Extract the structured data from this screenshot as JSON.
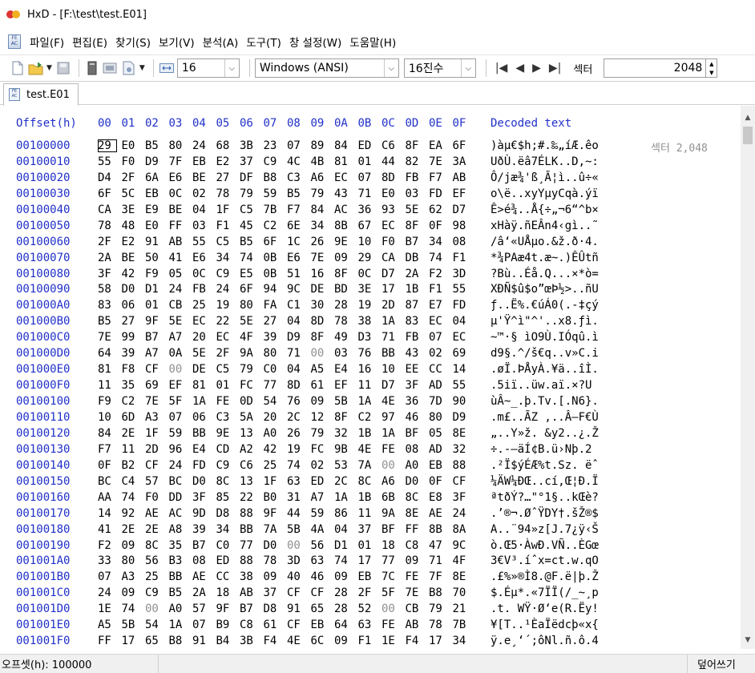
{
  "window": {
    "title": "HxD - [F:\\test\\test.E01]"
  },
  "menu": [
    "파일(F)",
    "편집(E)",
    "찾기(S)",
    "보기(V)",
    "분석(A)",
    "도구(T)",
    "창 설정(W)",
    "도움말(H)"
  ],
  "toolbar": {
    "bytes_per_row": "16",
    "charset": "Windows (ANSI)",
    "offset_base": "16진수",
    "sector_label": "섹터",
    "sector_value": "2048"
  },
  "tab": {
    "label": "test.E01"
  },
  "editor": {
    "offset_header": "Offset(h)",
    "column_headers": [
      "00",
      "01",
      "02",
      "03",
      "04",
      "05",
      "06",
      "07",
      "08",
      "09",
      "0A",
      "0B",
      "0C",
      "0D",
      "0E",
      "0F"
    ],
    "decoded_header": "Decoded text",
    "sector_marker": "섹터 2,048",
    "rows": [
      {
        "offset": "00100000",
        "hex": [
          "29",
          "E0",
          "B5",
          "80",
          "24",
          "68",
          "3B",
          "23",
          "07",
          "89",
          "84",
          "ED",
          "C6",
          "8F",
          "EA",
          "6F"
        ],
        "text": ")àµ€$h;#.‰„íÆ.êo"
      },
      {
        "offset": "00100010",
        "hex": [
          "55",
          "F0",
          "D9",
          "7F",
          "EB",
          "E2",
          "37",
          "C9",
          "4C",
          "4B",
          "81",
          "01",
          "44",
          "82",
          "7E",
          "3A"
        ],
        "text": "UðÙ.ëâ7ÉLK..D‚~:"
      },
      {
        "offset": "00100020",
        "hex": [
          "D4",
          "2F",
          "6A",
          "E6",
          "BE",
          "27",
          "DF",
          "B8",
          "C3",
          "A6",
          "EC",
          "07",
          "8D",
          "FB",
          "F7",
          "AB"
        ],
        "text": "Ô/jæ¾'ß¸Ã¦ì..û÷«"
      },
      {
        "offset": "00100030",
        "hex": [
          "6F",
          "5C",
          "EB",
          "0C",
          "02",
          "78",
          "79",
          "59",
          "B5",
          "79",
          "43",
          "71",
          "E0",
          "03",
          "FD",
          "EF"
        ],
        "text": "o\\ë..xyYµyCqà.ýï"
      },
      {
        "offset": "00100040",
        "hex": [
          "CA",
          "3E",
          "E9",
          "BE",
          "04",
          "1F",
          "C5",
          "7B",
          "F7",
          "84",
          "AC",
          "36",
          "93",
          "5E",
          "62",
          "D7"
        ],
        "text": "Ê>é¾..Å{÷„¬6“^b×"
      },
      {
        "offset": "00100050",
        "hex": [
          "78",
          "48",
          "E0",
          "FF",
          "03",
          "F1",
          "45",
          "C2",
          "6E",
          "34",
          "8B",
          "67",
          "EC",
          "8F",
          "0F",
          "98"
        ],
        "text": "xHàÿ.ñEÂn4‹gì..˜"
      },
      {
        "offset": "00100060",
        "hex": [
          "2F",
          "E2",
          "91",
          "AB",
          "55",
          "C5",
          "B5",
          "6F",
          "1C",
          "26",
          "9E",
          "10",
          "F0",
          "B7",
          "34",
          "08"
        ],
        "text": "/â‘«UÅµo.&ž.ð·4."
      },
      {
        "offset": "00100070",
        "hex": [
          "2A",
          "BE",
          "50",
          "41",
          "E6",
          "34",
          "74",
          "0B",
          "E6",
          "7E",
          "09",
          "29",
          "CA",
          "DB",
          "74",
          "F1"
        ],
        "text": "*¾PAæ4t.æ~.)ÊÛtñ"
      },
      {
        "offset": "00100080",
        "hex": [
          "3F",
          "42",
          "F9",
          "05",
          "0C",
          "C9",
          "E5",
          "0B",
          "51",
          "16",
          "8F",
          "0C",
          "D7",
          "2A",
          "F2",
          "3D"
        ],
        "text": "?Bù..Éå.Q...×*ò="
      },
      {
        "offset": "00100090",
        "hex": [
          "58",
          "D0",
          "D1",
          "24",
          "FB",
          "24",
          "6F",
          "94",
          "9C",
          "DE",
          "BD",
          "3E",
          "17",
          "1B",
          "F1",
          "55"
        ],
        "text": "XÐÑ$û$o”œÞ½>..ñU"
      },
      {
        "offset": "001000A0",
        "hex": [
          "83",
          "06",
          "01",
          "CB",
          "25",
          "19",
          "80",
          "FA",
          "C1",
          "30",
          "28",
          "19",
          "2D",
          "87",
          "E7",
          "FD"
        ],
        "text": "ƒ..Ë%.€úÁ0(.-‡çý"
      },
      {
        "offset": "001000B0",
        "hex": [
          "B5",
          "27",
          "9F",
          "5E",
          "EC",
          "22",
          "5E",
          "27",
          "04",
          "8D",
          "78",
          "38",
          "1A",
          "83",
          "EC",
          "04"
        ],
        "text": "µ'Ÿ^ì\"^'..x8.ƒì."
      },
      {
        "offset": "001000C0",
        "hex": [
          "7E",
          "99",
          "B7",
          "A7",
          "20",
          "EC",
          "4F",
          "39",
          "D9",
          "8F",
          "49",
          "D3",
          "71",
          "FB",
          "07",
          "EC"
        ],
        "text": "~™·§ ìO9Ù.IÓqû.ì"
      },
      {
        "offset": "001000D0",
        "hex": [
          "64",
          "39",
          "A7",
          "0A",
          "5E",
          "2F",
          "9A",
          "80",
          "71",
          "00",
          "03",
          "76",
          "BB",
          "43",
          "02",
          "69"
        ],
        "text": "d9§.^/š€q..v»C.i"
      },
      {
        "offset": "001000E0",
        "hex": [
          "81",
          "F8",
          "CF",
          "00",
          "DE",
          "C5",
          "79",
          "C0",
          "04",
          "A5",
          "E4",
          "16",
          "10",
          "EE",
          "CC",
          "14"
        ],
        "text": ".øÏ.ÞÅyÀ.¥ä..îÌ."
      },
      {
        "offset": "001000F0",
        "hex": [
          "11",
          "35",
          "69",
          "EF",
          "81",
          "01",
          "FC",
          "77",
          "8D",
          "61",
          "EF",
          "11",
          "D7",
          "3F",
          "AD",
          "55"
        ],
        "text": ".5iï..üw.aï.×?­U"
      },
      {
        "offset": "00100100",
        "hex": [
          "F9",
          "C2",
          "7E",
          "5F",
          "1A",
          "FE",
          "0D",
          "54",
          "76",
          "09",
          "5B",
          "1A",
          "4E",
          "36",
          "7D",
          "90"
        ],
        "text": "ùÂ~_.þ.Tv.[.N6}."
      },
      {
        "offset": "00100110",
        "hex": [
          "10",
          "6D",
          "A3",
          "07",
          "06",
          "C3",
          "5A",
          "20",
          "2C",
          "12",
          "8F",
          "C2",
          "97",
          "46",
          "80",
          "D9"
        ],
        "text": ".m£..ÃZ ,..Â—F€Ù"
      },
      {
        "offset": "00100120",
        "hex": [
          "84",
          "2E",
          "1F",
          "59",
          "BB",
          "9E",
          "13",
          "A0",
          "26",
          "79",
          "32",
          "1B",
          "1A",
          "BF",
          "05",
          "8E"
        ],
        "text": "„..Y»ž. &y2..¿.Ž"
      },
      {
        "offset": "00100130",
        "hex": [
          "F7",
          "11",
          "2D",
          "96",
          "E4",
          "CD",
          "A2",
          "42",
          "19",
          "FC",
          "9B",
          "4E",
          "FE",
          "08",
          "AD",
          "32"
        ],
        "text": "÷.-–äÍ¢B.ü›Nþ.­2"
      },
      {
        "offset": "00100140",
        "hex": [
          "0F",
          "B2",
          "CF",
          "24",
          "FD",
          "C9",
          "C6",
          "25",
          "74",
          "02",
          "53",
          "7A",
          "00",
          "A0",
          "EB",
          "88"
        ],
        "text": ".²Ï$ýÉÆ%t.Sz. ëˆ"
      },
      {
        "offset": "00100150",
        "hex": [
          "BC",
          "C4",
          "57",
          "BC",
          "D0",
          "8C",
          "13",
          "1F",
          "63",
          "ED",
          "2C",
          "8C",
          "A6",
          "D0",
          "0F",
          "CF"
        ],
        "text": "¼ÄW¼ÐŒ..cí,Œ¦Ð.Ï"
      },
      {
        "offset": "00100160",
        "hex": [
          "AA",
          "74",
          "F0",
          "DD",
          "3F",
          "85",
          "22",
          "B0",
          "31",
          "A7",
          "1A",
          "1B",
          "6B",
          "8C",
          "E8",
          "3F"
        ],
        "text": "ªtðÝ?…\"°1§..kŒè?"
      },
      {
        "offset": "00100170",
        "hex": [
          "14",
          "92",
          "AE",
          "AC",
          "9D",
          "D8",
          "88",
          "9F",
          "44",
          "59",
          "86",
          "11",
          "9A",
          "8E",
          "AE",
          "24"
        ],
        "text": ".’®¬.ØˆŸDY†.šŽ®$"
      },
      {
        "offset": "00100180",
        "hex": [
          "41",
          "2E",
          "2E",
          "A8",
          "39",
          "34",
          "BB",
          "7A",
          "5B",
          "4A",
          "04",
          "37",
          "BF",
          "FF",
          "8B",
          "8A"
        ],
        "text": "A..¨94»z[J.7¿ÿ‹Š"
      },
      {
        "offset": "00100190",
        "hex": [
          "F2",
          "09",
          "8C",
          "35",
          "B7",
          "C0",
          "77",
          "D0",
          "00",
          "56",
          "D1",
          "01",
          "18",
          "C8",
          "47",
          "9C"
        ],
        "text": "ò.Œ5·ÀwÐ.VÑ..ÈGœ"
      },
      {
        "offset": "001001A0",
        "hex": [
          "33",
          "80",
          "56",
          "B3",
          "08",
          "ED",
          "88",
          "78",
          "3D",
          "63",
          "74",
          "17",
          "77",
          "09",
          "71",
          "4F"
        ],
        "text": "3€V³.íˆx=ct.w.qO"
      },
      {
        "offset": "001001B0",
        "hex": [
          "07",
          "A3",
          "25",
          "BB",
          "AE",
          "CC",
          "38",
          "09",
          "40",
          "46",
          "09",
          "EB",
          "7C",
          "FE",
          "7F",
          "8E"
        ],
        "text": ".£%»®Ì8.@F.ë|þ.Ž"
      },
      {
        "offset": "001001C0",
        "hex": [
          "24",
          "09",
          "C9",
          "B5",
          "2A",
          "18",
          "AB",
          "37",
          "CF",
          "CF",
          "28",
          "2F",
          "5F",
          "7E",
          "B8",
          "70"
        ],
        "text": "$.Éµ*.«7ÏÏ(/_~¸p"
      },
      {
        "offset": "001001D0",
        "hex": [
          "1E",
          "74",
          "00",
          "A0",
          "57",
          "9F",
          "B7",
          "D8",
          "91",
          "65",
          "28",
          "52",
          "00",
          "CB",
          "79",
          "21"
        ],
        "text": ".t. WŸ·Ø‘e(R.Ëy!"
      },
      {
        "offset": "001001E0",
        "hex": [
          "A5",
          "5B",
          "54",
          "1A",
          "07",
          "B9",
          "C8",
          "61",
          "CF",
          "EB",
          "64",
          "63",
          "FE",
          "AB",
          "78",
          "7B"
        ],
        "text": "¥[T..¹ÈaÏëdcþ«x{"
      },
      {
        "offset": "001001F0",
        "hex": [
          "FF",
          "17",
          "65",
          "B8",
          "91",
          "B4",
          "3B",
          "F4",
          "4E",
          "6C",
          "09",
          "F1",
          "1E",
          "F4",
          "17",
          "34"
        ],
        "text": "ÿ.e¸‘´;ôNl.ñ.ô.4"
      }
    ]
  },
  "status": {
    "offset": "오프셋(h): 100000",
    "mode": "덮어쓰기"
  }
}
